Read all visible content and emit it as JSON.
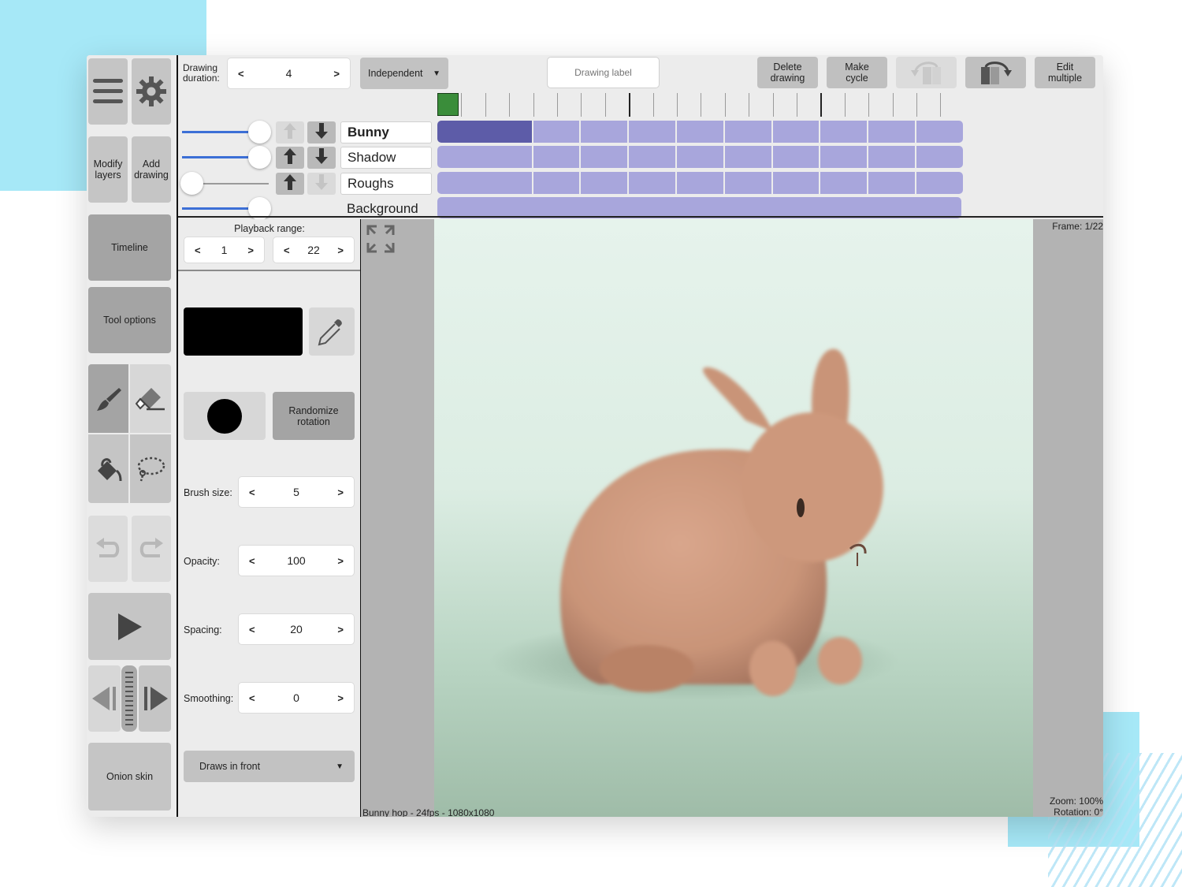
{
  "top_bar": {
    "drawing_duration_label": "Drawing duration:",
    "drawing_duration_value": "4",
    "dec": "<",
    "inc": ">",
    "mode_dropdown": "Independent",
    "drawing_label_placeholder": "Drawing label",
    "delete_drawing": "Delete drawing",
    "make_cycle": "Make cycle",
    "edit_multiple": "Edit multiple"
  },
  "left_toolbar": {
    "modify_layers": "Modify layers",
    "add_drawing": "Add drawing",
    "timeline": "Timeline",
    "tool_options": "Tool options",
    "onion_skin": "Onion skin"
  },
  "layers": [
    {
      "name": "Bunny",
      "opacity": 1.0,
      "active": true,
      "up_enabled": false,
      "down_enabled": true
    },
    {
      "name": "Shadow",
      "opacity": 1.0,
      "active": false,
      "up_enabled": true,
      "down_enabled": true
    },
    {
      "name": "Roughs",
      "opacity": 0.0,
      "active": false,
      "up_enabled": true,
      "down_enabled": false
    },
    {
      "name": "Background",
      "opacity": 1.0,
      "active": false,
      "up_enabled": null,
      "down_enabled": null
    }
  ],
  "timeline": {
    "current_frame": 1,
    "total_frames": 22,
    "drawing_duration": 4
  },
  "tool_options": {
    "playback_range_label": "Playback range:",
    "playback_start": "1",
    "playback_end": "22",
    "color": "#000000",
    "randomize_rotation": "Randomize rotation",
    "brush_size_label": "Brush size:",
    "brush_size": "5",
    "opacity_label": "Opacity:",
    "opacity": "100",
    "spacing_label": "Spacing:",
    "spacing": "20",
    "smoothing_label": "Smoothing:",
    "smoothing": "0",
    "draw_order": "Draws in front"
  },
  "canvas": {
    "frame_info": "Frame: 1/22",
    "project_info": "Bunny hop - 24fps - 1080x1080",
    "zoom_info": "Zoom: 100%",
    "rotation_info": "Rotation: 0°"
  },
  "colors": {
    "accent_blue": "#3c6fd6",
    "cell": "#a8a6dc",
    "cell_selected": "#5d5ca8",
    "current_frame": "#3a8d3a",
    "deco_cyan": "#a6e8f7"
  }
}
